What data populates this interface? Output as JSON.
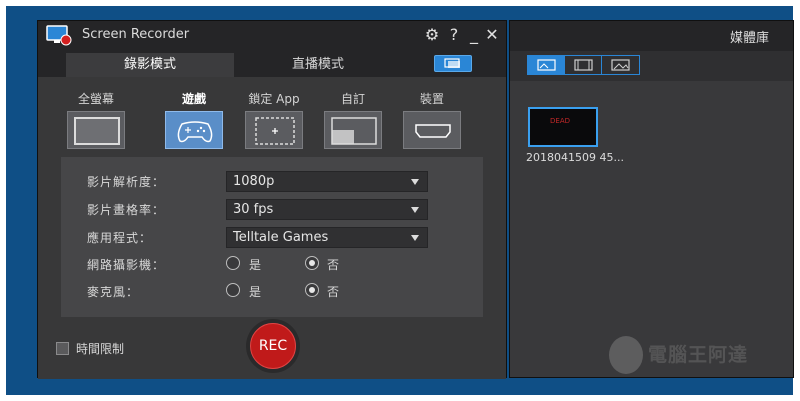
{
  "app": {
    "title": "Screen Recorder"
  },
  "titlebar": {
    "settings_icon": "gear-icon",
    "help_label": "?",
    "minimize_label": "_",
    "close_label": "✕"
  },
  "tabs": [
    {
      "label": "錄影模式",
      "active": true
    },
    {
      "label": "直播模式",
      "active": false
    }
  ],
  "modes": [
    {
      "label": "全螢幕",
      "icon": "fullscreen-icon",
      "active": false
    },
    {
      "label": "遊戲",
      "icon": "gamepad-icon",
      "active": true
    },
    {
      "label": "鎖定 App",
      "icon": "lock-app-icon",
      "active": false
    },
    {
      "label": "自訂",
      "icon": "custom-region-icon",
      "active": false
    },
    {
      "label": "裝置",
      "icon": "hdmi-device-icon",
      "active": false
    }
  ],
  "settings": {
    "resolution": {
      "label": "影片解析度：",
      "value": "1080p"
    },
    "framerate": {
      "label": "影片畫格率：",
      "value": "30 fps"
    },
    "application": {
      "label": "應用程式：",
      "value": "Telltale Games"
    },
    "webcam": {
      "label": "網路攝影機：",
      "yes": "是",
      "no": "否",
      "selected": "no"
    },
    "microphone": {
      "label": "麥克風：",
      "yes": "是",
      "no": "否",
      "selected": "no"
    }
  },
  "time_limit": {
    "label": "時間限制",
    "checked": false
  },
  "rec_button": {
    "label": "REC",
    "color": "#c01a1a"
  },
  "media_library": {
    "title": "媒體庫",
    "toolbar_icons": [
      "video-library-icon",
      "film-strip-icon",
      "image-icon"
    ],
    "items": [
      {
        "thumb_text": "DEAD",
        "name": "2018041509 45..."
      }
    ]
  },
  "watermark": {
    "text": "電腦王阿達"
  },
  "colors": {
    "accent": "#2a86d6",
    "rec": "#c01a1a",
    "desktop": "#0f4f86"
  }
}
